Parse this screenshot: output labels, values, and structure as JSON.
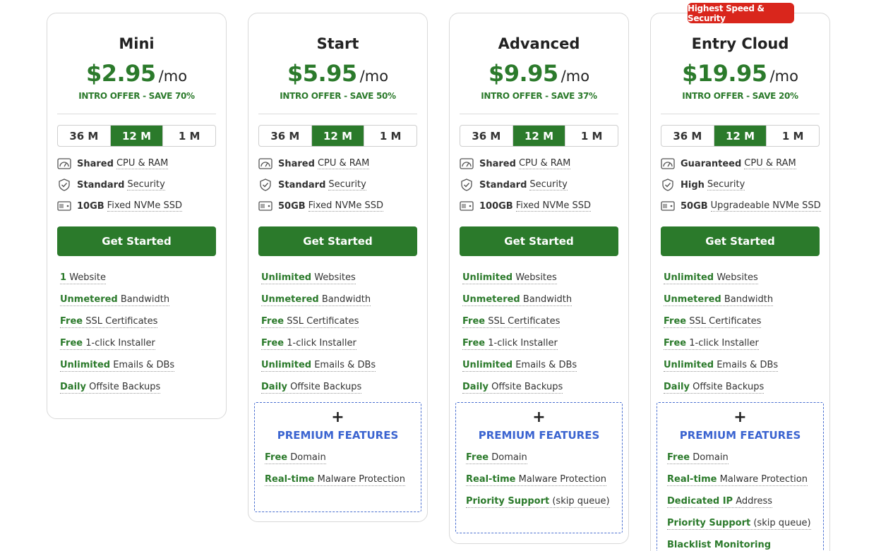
{
  "ribbon": "Highest Speed & Security",
  "per_label": "/mo",
  "cta_label": "Get Started",
  "premium_plus": "+",
  "premium_title": "PREMIUM FEATURES",
  "terms": [
    "36 M",
    "12 M",
    "1 M"
  ],
  "selected_term": "12 M",
  "colors": {
    "accent_green": "#2b7a2b",
    "ribbon_red": "#d9261c",
    "premium_blue": "#3b64d0"
  },
  "icons": [
    "speedometer-icon",
    "shield-check-icon",
    "ssd-drive-icon"
  ],
  "plans": [
    {
      "name": "Mini",
      "price": "$2.95",
      "intro": "INTRO OFFER - SAVE 70%",
      "specs": [
        {
          "bold": "Shared",
          "text": "CPU & RAM"
        },
        {
          "bold": "Standard",
          "text": "Security"
        },
        {
          "bold": "10GB",
          "text": "Fixed NVMe SSD"
        }
      ],
      "features": [
        {
          "hl": "1",
          "text": "Website"
        },
        {
          "hl": "Unmetered",
          "text": "Bandwidth"
        },
        {
          "hl": "Free",
          "text": "SSL Certificates"
        },
        {
          "hl": "Free",
          "text": "1-click Installer"
        },
        {
          "hl": "Unlimited",
          "text": "Emails & DBs"
        },
        {
          "hl": "Daily",
          "text": "Offsite Backups"
        }
      ]
    },
    {
      "name": "Start",
      "price": "$5.95",
      "intro": "INTRO OFFER - SAVE 50%",
      "specs": [
        {
          "bold": "Shared",
          "text": "CPU & RAM"
        },
        {
          "bold": "Standard",
          "text": "Security"
        },
        {
          "bold": "50GB",
          "text": "Fixed NVMe SSD"
        }
      ],
      "features": [
        {
          "hl": "Unlimited",
          "text": "Websites"
        },
        {
          "hl": "Unmetered",
          "text": "Bandwidth"
        },
        {
          "hl": "Free",
          "text": "SSL Certificates"
        },
        {
          "hl": "Free",
          "text": "1-click Installer"
        },
        {
          "hl": "Unlimited",
          "text": "Emails & DBs"
        },
        {
          "hl": "Daily",
          "text": "Offsite Backups"
        }
      ],
      "premium": [
        {
          "hl": "Free",
          "text": "Domain"
        },
        {
          "hl": "Real-time",
          "text": "Malware Protection"
        }
      ]
    },
    {
      "name": "Advanced",
      "price": "$9.95",
      "intro": "INTRO OFFER - SAVE 37%",
      "specs": [
        {
          "bold": "Shared",
          "text": "CPU & RAM"
        },
        {
          "bold": "Standard",
          "text": "Security"
        },
        {
          "bold": "100GB",
          "text": "Fixed NVMe SSD"
        }
      ],
      "features": [
        {
          "hl": "Unlimited",
          "text": "Websites"
        },
        {
          "hl": "Unmetered",
          "text": "Bandwidth"
        },
        {
          "hl": "Free",
          "text": "SSL Certificates"
        },
        {
          "hl": "Free",
          "text": "1-click Installer"
        },
        {
          "hl": "Unlimited",
          "text": "Emails & DBs"
        },
        {
          "hl": "Daily",
          "text": "Offsite Backups"
        }
      ],
      "premium": [
        {
          "hl": "Free",
          "text": "Domain"
        },
        {
          "hl": "Real-time",
          "text": "Malware Protection"
        },
        {
          "hl": "Priority Support",
          "text": "(skip queue)"
        }
      ]
    },
    {
      "name": "Entry Cloud",
      "price": "$19.95",
      "intro": "INTRO OFFER - SAVE 20%",
      "specs": [
        {
          "bold": "Guaranteed",
          "text": "CPU & RAM"
        },
        {
          "bold": "High",
          "text": "Security"
        },
        {
          "bold": "50GB",
          "text": "Upgradeable NVMe SSD"
        }
      ],
      "features": [
        {
          "hl": "Unlimited",
          "text": "Websites"
        },
        {
          "hl": "Unmetered",
          "text": "Bandwidth"
        },
        {
          "hl": "Free",
          "text": "SSL Certificates"
        },
        {
          "hl": "Free",
          "text": "1-click Installer"
        },
        {
          "hl": "Unlimited",
          "text": "Emails & DBs"
        },
        {
          "hl": "Daily",
          "text": "Offsite Backups"
        }
      ],
      "premium": [
        {
          "hl": "Free",
          "text": "Domain"
        },
        {
          "hl": "Real-time",
          "text": "Malware Protection"
        },
        {
          "hl": "Dedicated IP",
          "text": "Address"
        },
        {
          "hl": "Priority Support",
          "text": "(skip queue)"
        },
        {
          "hl": "Blacklist Monitoring",
          "text": ""
        }
      ]
    }
  ]
}
